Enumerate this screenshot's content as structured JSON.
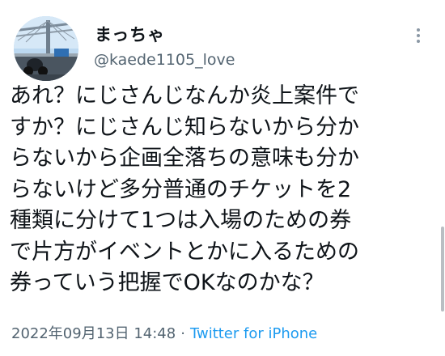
{
  "tweet": {
    "display_name": "まっちゃ",
    "handle": "@kaede1105_love",
    "body_lines": [
      "あれ？にじさんじなんか炎上案件で",
      "すか？にじさんじ知らないから分か",
      "らないから企画全落ちの意味も分か",
      "らないけど多分普通のチケットを2",
      "種類に分けて1つは入場のための券",
      "で片方がイベントとかに入るための",
      "券っていう把握でOKなのかな？"
    ],
    "date": "2022年09月13日 14:48",
    "separator": "·",
    "source": "Twitter for iPhone"
  },
  "icons": {
    "more": "more-vertical-icon",
    "avatar": "avatar-photo-bridge"
  },
  "colors": {
    "text": "#0f1419",
    "muted": "#536471",
    "link": "#1d9bf0"
  }
}
